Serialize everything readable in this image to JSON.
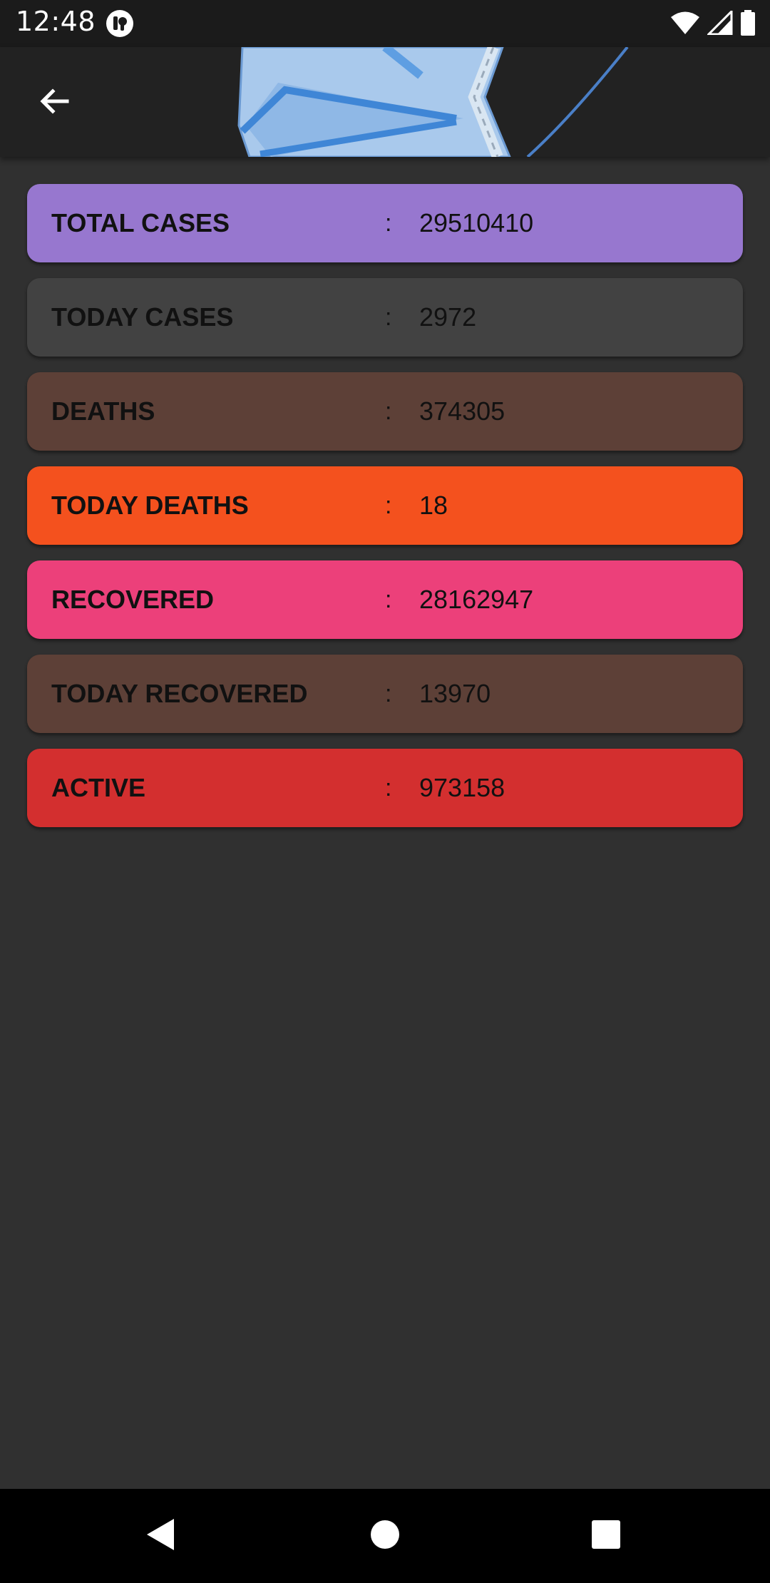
{
  "status_bar": {
    "time": "12:48",
    "icons": [
      "app-notification-icon",
      "wifi-icon",
      "signal-icon",
      "battery-icon"
    ]
  },
  "app_bar": {
    "back_icon": "arrow-back-icon",
    "header_image": "face-mask-illustration"
  },
  "colors": {
    "background": "#303030",
    "app_bar": "#222222",
    "total_cases": "#9777CF",
    "today_cases": "#424242",
    "deaths": "#5D4037",
    "today_deaths": "#F4511E",
    "recovered": "#EC407A",
    "today_recovered": "#5D4037",
    "active": "#D32F2F"
  },
  "stats": [
    {
      "label": "TOTAL CASES",
      "separator": ":",
      "value": "29510410"
    },
    {
      "label": "TODAY CASES",
      "separator": ":",
      "value": "2972"
    },
    {
      "label": "DEATHS",
      "separator": ":",
      "value": "374305"
    },
    {
      "label": "TODAY DEATHS",
      "separator": ":",
      "value": "18"
    },
    {
      "label": "RECOVERED",
      "separator": ":",
      "value": "28162947"
    },
    {
      "label": "TODAY RECOVERED",
      "separator": ":",
      "value": "13970"
    },
    {
      "label": "ACTIVE",
      "separator": ":",
      "value": "973158"
    }
  ],
  "nav_bar": {
    "icons": [
      "nav-back-icon",
      "nav-home-icon",
      "nav-recents-icon"
    ]
  }
}
